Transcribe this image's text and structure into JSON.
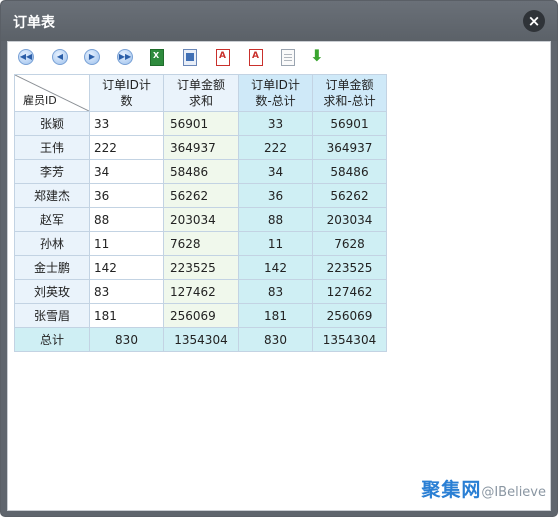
{
  "window": {
    "title": "订单表",
    "close_symbol": "×"
  },
  "toolbar": {
    "buttons": [
      {
        "icon": "first-page-icon",
        "glyph": "◀◀"
      },
      {
        "icon": "prev-page-icon",
        "glyph": "◀"
      },
      {
        "icon": "next-page-icon",
        "glyph": "▶"
      },
      {
        "icon": "last-page-icon",
        "glyph": "▶▶"
      },
      {
        "icon": "export-excel-icon",
        "glyph": "X"
      },
      {
        "icon": "export-word-icon",
        "glyph": ""
      },
      {
        "icon": "export-pdf-icon",
        "glyph": "A"
      },
      {
        "icon": "export-pdf-alt-icon",
        "glyph": "A"
      },
      {
        "icon": "export-text-icon",
        "glyph": ""
      },
      {
        "icon": "download-icon",
        "glyph": "⬇"
      }
    ]
  },
  "table": {
    "corner_label": "雇员ID",
    "headers": [
      [
        "订单ID计",
        "数"
      ],
      [
        "订单金额",
        "求和"
      ],
      [
        "订单ID计",
        "数-总计"
      ],
      [
        "订单金额",
        "求和-总计"
      ]
    ],
    "rows": [
      {
        "name": "张颖",
        "count": "33",
        "amount": "56901",
        "count_total": "33",
        "amount_total": "56901"
      },
      {
        "name": "王伟",
        "count": "222",
        "amount": "364937",
        "count_total": "222",
        "amount_total": "364937"
      },
      {
        "name": "李芳",
        "count": "34",
        "amount": "58486",
        "count_total": "34",
        "amount_total": "58486"
      },
      {
        "name": "郑建杰",
        "count": "36",
        "amount": "56262",
        "count_total": "36",
        "amount_total": "56262"
      },
      {
        "name": "赵军",
        "count": "88",
        "amount": "203034",
        "count_total": "88",
        "amount_total": "203034"
      },
      {
        "name": "孙林",
        "count": "11",
        "amount": "7628",
        "count_total": "11",
        "amount_total": "7628"
      },
      {
        "name": "金士鹏",
        "count": "142",
        "amount": "223525",
        "count_total": "142",
        "amount_total": "223525"
      },
      {
        "name": "刘英玫",
        "count": "83",
        "amount": "127462",
        "count_total": "83",
        "amount_total": "127462"
      },
      {
        "name": "张雪眉",
        "count": "181",
        "amount": "256069",
        "count_total": "181",
        "amount_total": "256069"
      }
    ],
    "total": {
      "name": "总计",
      "count": "830",
      "amount": "1354304",
      "count_total": "830",
      "amount_total": "1354304"
    }
  },
  "watermark": {
    "brand": "聚集网",
    "handle": "@IBelieve"
  }
}
